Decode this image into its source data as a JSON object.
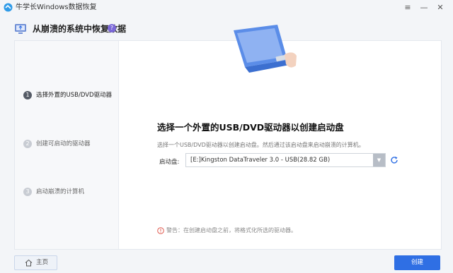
{
  "app": {
    "title": "牛学长Windows数据恢复"
  },
  "window_controls": {
    "menu": "≡",
    "minimize": "—",
    "close": "✕"
  },
  "header": {
    "title": "从崩溃的系统中恢复数据",
    "help": "?"
  },
  "steps": [
    {
      "num": "1",
      "label": "选择外置的USB/DVD驱动器",
      "active": true
    },
    {
      "num": "2",
      "label": "创建可启动的驱动器",
      "active": false
    },
    {
      "num": "3",
      "label": "启动崩溃的计算机",
      "active": false
    }
  ],
  "main": {
    "heading": "选择一个外置的USB/DVD驱动器以创建启动盘",
    "description": "选择一个USB/DVD驱动器以创建启动盘。然后通过该启动盘来启动崩溃的计算机。",
    "drive_label": "启动盘:",
    "drive_value": "[E:]Kingston DataTraveler 3.0 - USB(28.82 GB)",
    "warning": "警告：在创建启动盘之前，将格式化所选的驱动器。"
  },
  "footer": {
    "home_label": "主页",
    "create_label": "创建"
  },
  "colors": {
    "accent": "#2f6fe4",
    "warning": "#e05a4f",
    "laptop": "#5b8de8"
  },
  "icons": [
    "app-logo-icon",
    "monitor-icon",
    "help-icon",
    "dropdown-arrow-icon",
    "refresh-icon",
    "warning-icon",
    "home-icon"
  ]
}
